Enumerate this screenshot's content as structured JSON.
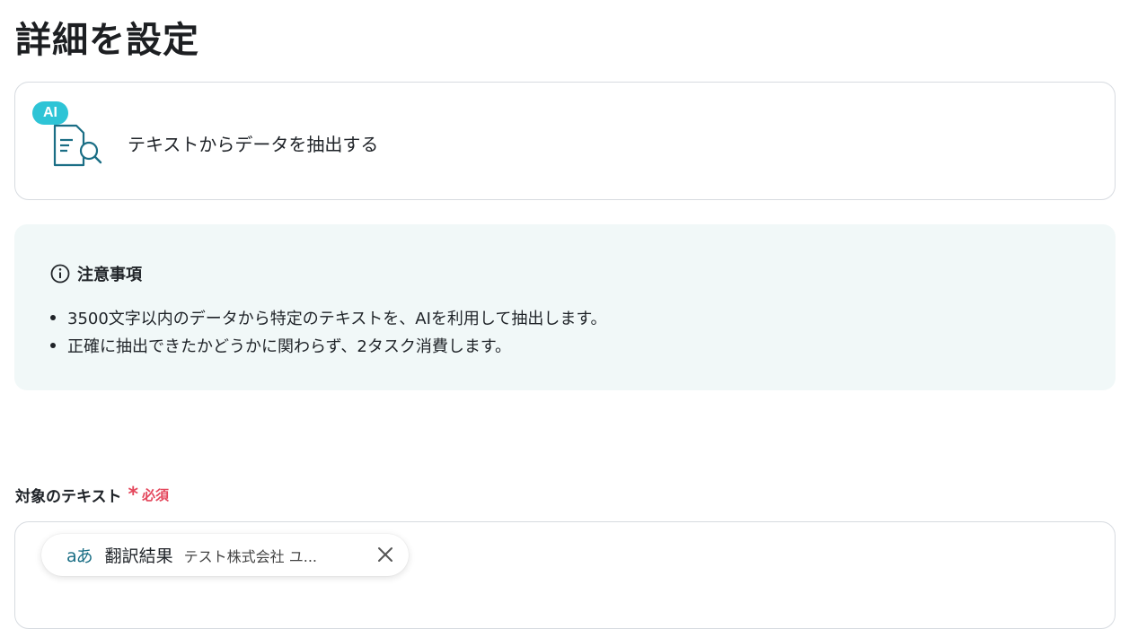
{
  "page": {
    "title": "詳細を設定"
  },
  "action": {
    "badge": "AI",
    "label": "テキストからデータを抽出する"
  },
  "notice": {
    "heading": "注意事項",
    "items": [
      "3500文字以内のデータから特定のテキストを、AIを利用して抽出します。",
      "正確に抽出できたかどうかに関わらず、2タスク消費します。"
    ]
  },
  "field": {
    "label": "対象のテキスト",
    "required_mark": "*",
    "required_text": "必須",
    "chip": {
      "icon": "translate-icon",
      "title": "翻訳結果",
      "value": "テスト株式会社 ユ..."
    }
  },
  "colors": {
    "accent": "#2ec4d6",
    "icon": "#1a6e85",
    "required": "#e4475c",
    "notice_bg": "#f1f8f8"
  }
}
